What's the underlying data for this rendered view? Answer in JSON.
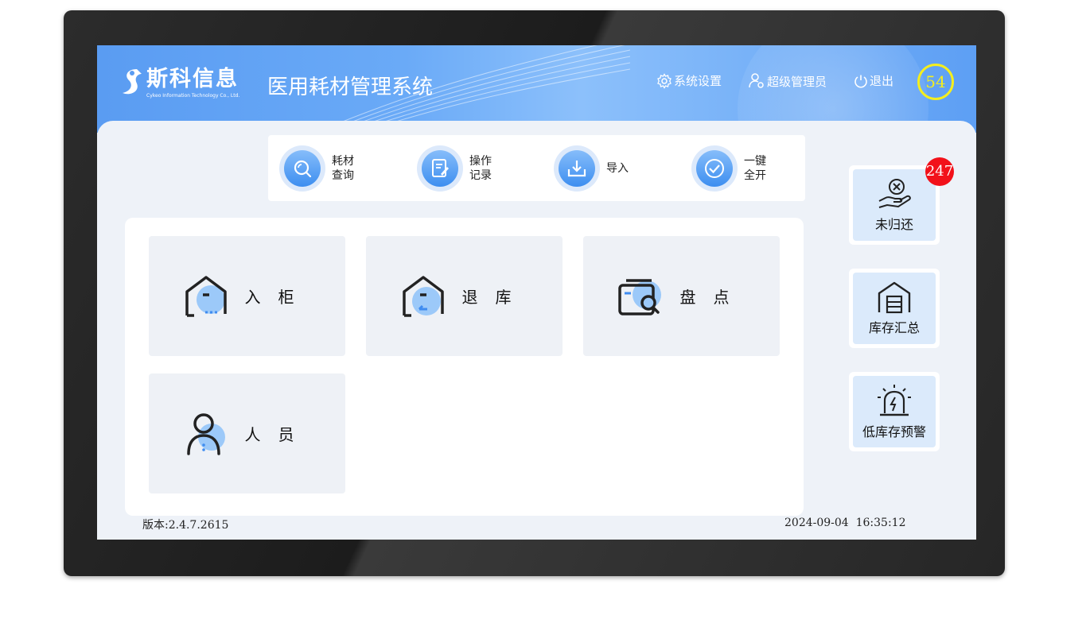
{
  "header": {
    "brand_cn": "斯科信息",
    "brand_en": "Cykeo Information Technology Co., Ltd.",
    "title": "医用耗材管理系统",
    "settings_label": "系统设置",
    "admin_label": "超级管理员",
    "logout_label": "退出",
    "counter": "54"
  },
  "toolbar": {
    "items": [
      {
        "label": "耗材查询",
        "icon": "search-icon"
      },
      {
        "label": "操作记录",
        "icon": "record-icon"
      },
      {
        "label": "导入",
        "icon": "download-icon"
      },
      {
        "label": "一键全开",
        "icon": "check-icon"
      }
    ]
  },
  "tiles": [
    {
      "label": "入柜",
      "icon": "cabinet-in-icon"
    },
    {
      "label": "退库",
      "icon": "return-stock-icon"
    },
    {
      "label": "盘点",
      "icon": "inventory-icon"
    },
    {
      "label": "人员",
      "icon": "person-icon"
    }
  ],
  "side": {
    "unreturned_label": "未归还",
    "unreturned_count": "247",
    "summary_label": "库存汇总",
    "low_stock_label": "低库存预警"
  },
  "footer": {
    "version": "版本:2.4.7.2615",
    "datetime": "2024-09-04  16:35:12"
  },
  "colors": {
    "accent": "#4a93f0",
    "badge_red": "#f2111a",
    "badge_yellow": "#f4ee1e"
  }
}
